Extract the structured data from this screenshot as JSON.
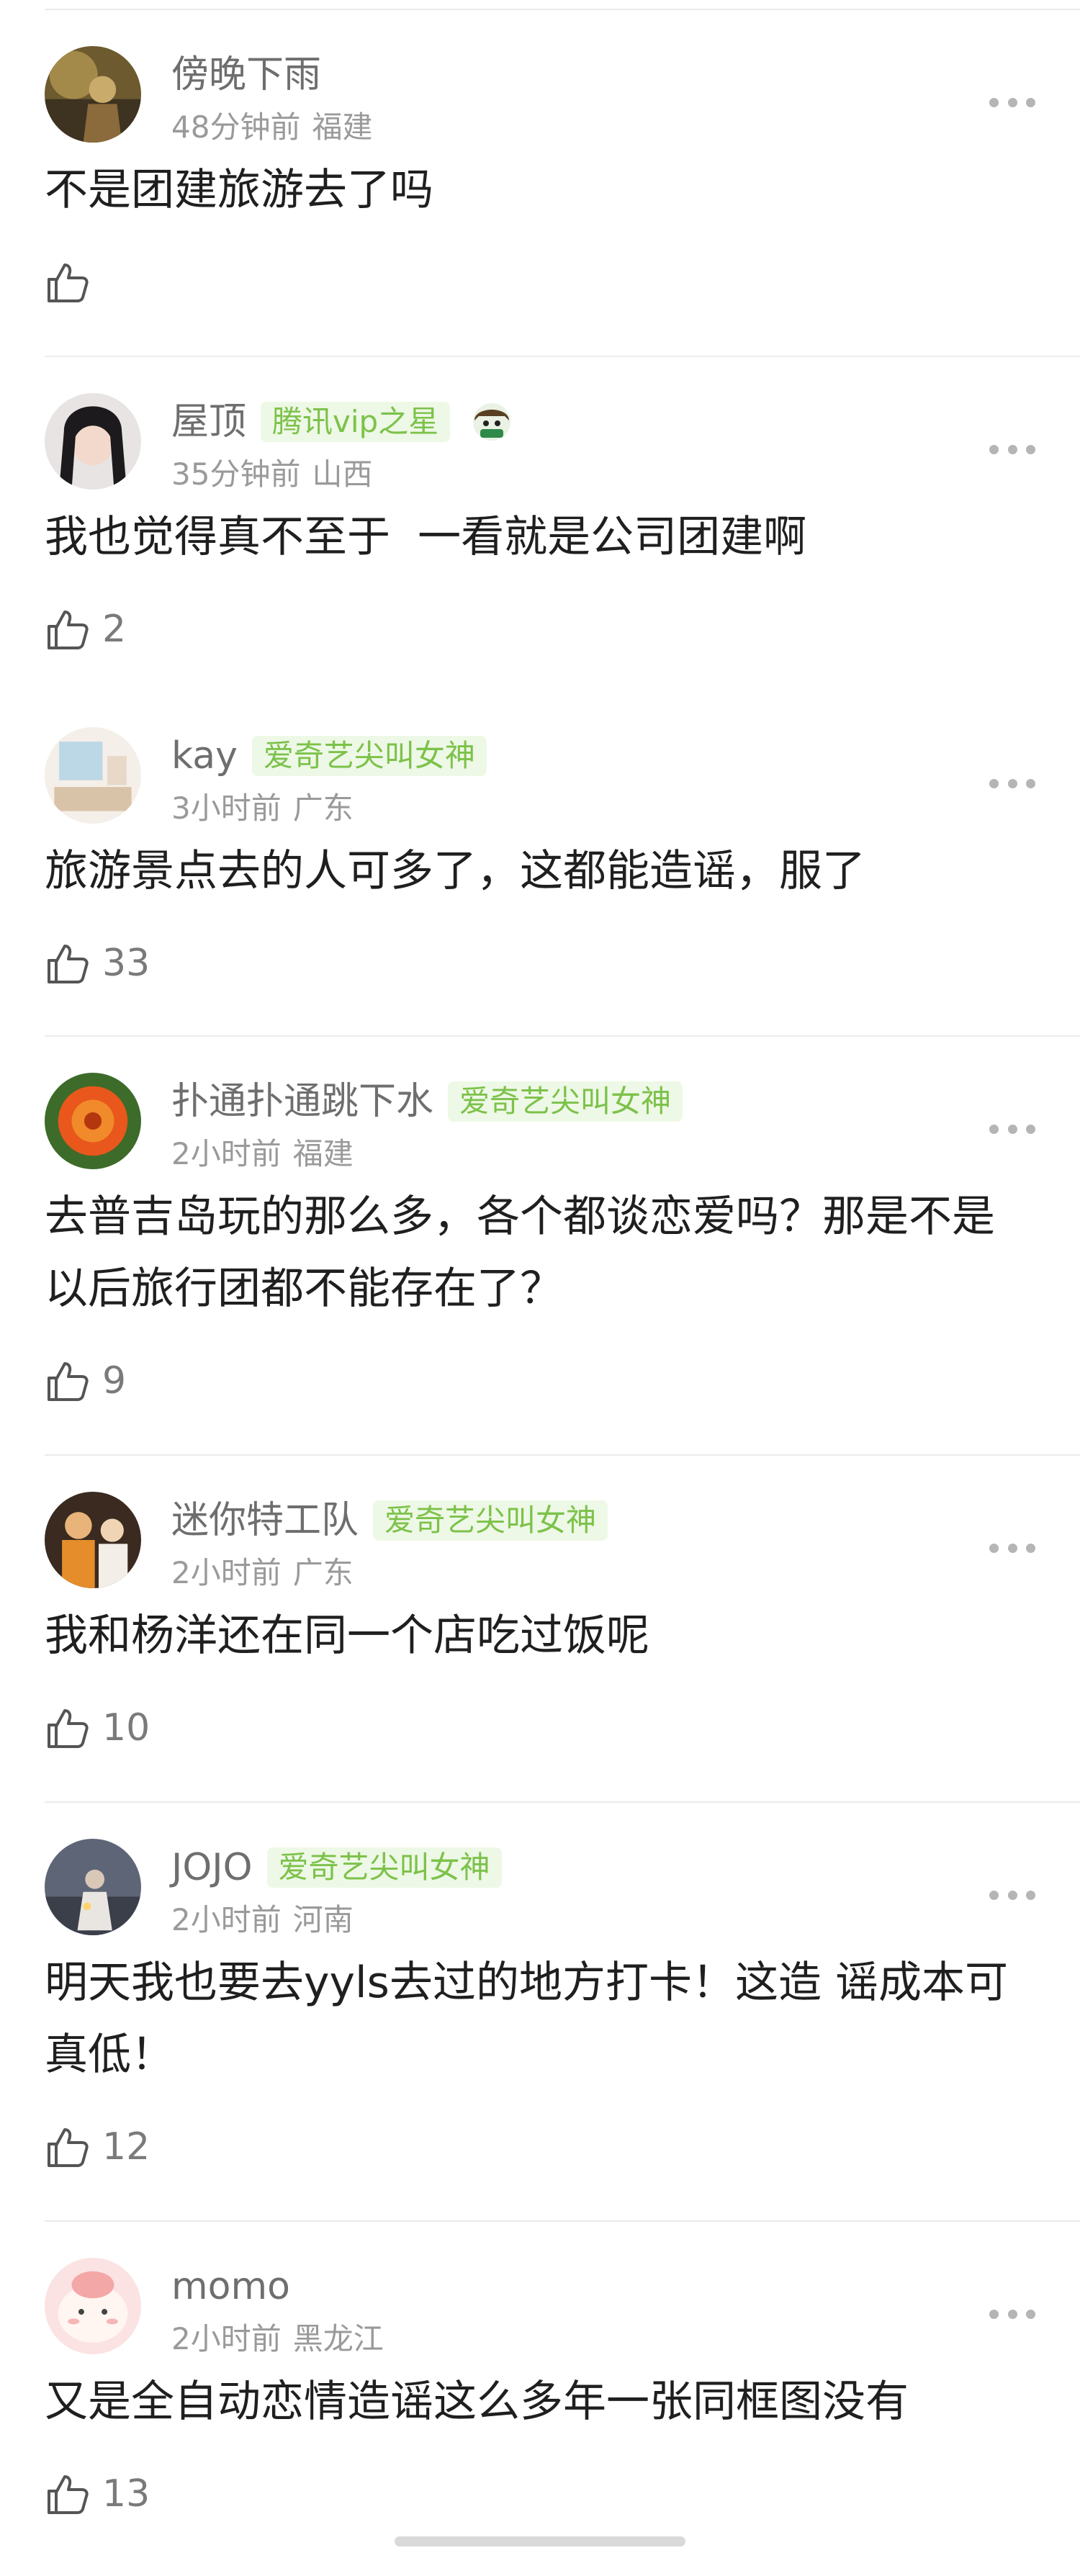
{
  "comments": [
    {
      "username": "傍晚下雨",
      "badge": "",
      "time": "48分钟前",
      "location": "福建",
      "content": "不是团建旅游去了吗",
      "likes": "",
      "avatar": "painting-avatar"
    },
    {
      "username": "屋顶",
      "badge": "腾讯vip之星",
      "time": "35分钟前",
      "location": "山西",
      "content": "我也觉得真不至于  一看就是公司团建啊",
      "likes": "2",
      "avatar": "girl-avatar",
      "extra_icon": "chibi-emoji-icon"
    },
    {
      "username": "kay",
      "badge": "爱奇艺尖叫女神",
      "time": "3小时前",
      "location": "广东",
      "content": "旅游景点去的人可多了，这都能造谣，服了",
      "likes": "33",
      "avatar": "room-avatar"
    },
    {
      "username": "扑通扑通跳下水",
      "badge": "爱奇艺尖叫女神",
      "time": "2小时前",
      "location": "福建",
      "content": "去普吉岛玩的那么多，各个都谈恋爱吗？那是不是以后旅行团都不能存在了？",
      "likes": "9",
      "avatar": "flower-avatar"
    },
    {
      "username": "迷你特工队",
      "badge": "爱奇艺尖叫女神",
      "time": "2小时前",
      "location": "广东",
      "content": "我和杨洋还在同一个店吃过饭呢",
      "likes": "10",
      "avatar": "people-avatar"
    },
    {
      "username": "JOJO",
      "badge": "爱奇艺尖叫女神",
      "time": "2小时前",
      "location": "河南",
      "content": "明天我也要去yyls去过的地方打卡！这造 谣成本可真低！",
      "likes": "12",
      "avatar": "night-avatar"
    },
    {
      "username": "momo",
      "badge": "",
      "time": "2小时前",
      "location": "黑龙江",
      "content": "又是全自动恋情造谣这么多年一张同框图没有",
      "likes": "13",
      "avatar": "cartoon-avatar"
    }
  ],
  "colors": {
    "badge_bg": "#eef8e6",
    "badge_text": "#7cc24a",
    "username": "#6e6e6e",
    "meta": "#9a9a9a"
  }
}
